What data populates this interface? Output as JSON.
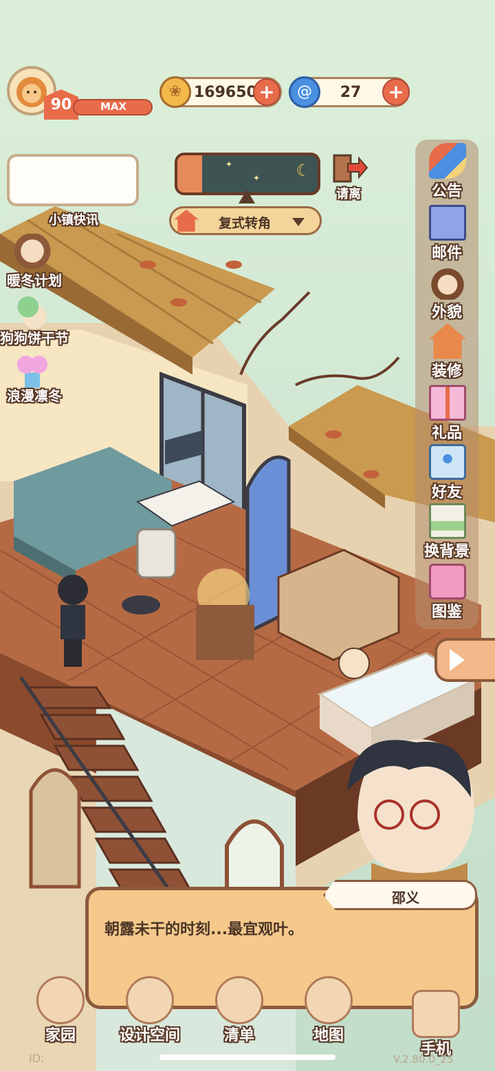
{
  "player": {
    "level": "90",
    "level_status": "MAX"
  },
  "currencies": {
    "coins": "169650",
    "gems": "27"
  },
  "top": {
    "news_label": "小镇快讯",
    "leave_label": "请离",
    "room_selector": "复式转角"
  },
  "events": [
    {
      "label": "暖冬计划",
      "icon": "girl-in-hat-icon"
    },
    {
      "label": "狗狗饼干节",
      "icon": "dog-bone-icon"
    },
    {
      "label": "浪漫凛冬",
      "icon": "gift-bow-icon"
    }
  ],
  "side_menu": [
    {
      "label": "公告",
      "icon": "megaphone-icon"
    },
    {
      "label": "邮件",
      "icon": "envelope-icon"
    },
    {
      "label": "外貌",
      "icon": "face-icon"
    },
    {
      "label": "装修",
      "icon": "house-wrench-icon"
    },
    {
      "label": "礼品",
      "icon": "gift-icon"
    },
    {
      "label": "好友",
      "icon": "friend-book-icon"
    },
    {
      "label": "换背景",
      "icon": "wallpaper-icon"
    },
    {
      "label": "图鉴",
      "icon": "album-icon"
    }
  ],
  "dialog": {
    "speaker": "邵义",
    "text": "朝露未干的时刻...最宜观叶。"
  },
  "bottom_nav": [
    {
      "label": "家园",
      "icon": "home-icon"
    },
    {
      "label": "设计空间",
      "icon": "design-icon"
    },
    {
      "label": "清单",
      "icon": "checklist-icon"
    },
    {
      "label": "地图",
      "icon": "map-icon"
    },
    {
      "label": "手机",
      "icon": "phone-icon"
    }
  ],
  "footer": {
    "id_prefix": "ID:",
    "version": "V.2.80.0_25"
  },
  "colors": {
    "sky": "#c9e2cc",
    "roof": "#c99a4f",
    "floor": "#b0623d",
    "panel": "#f4c98b",
    "panel_border": "#8b5a3c",
    "accent_orange": "#e86b4a"
  }
}
